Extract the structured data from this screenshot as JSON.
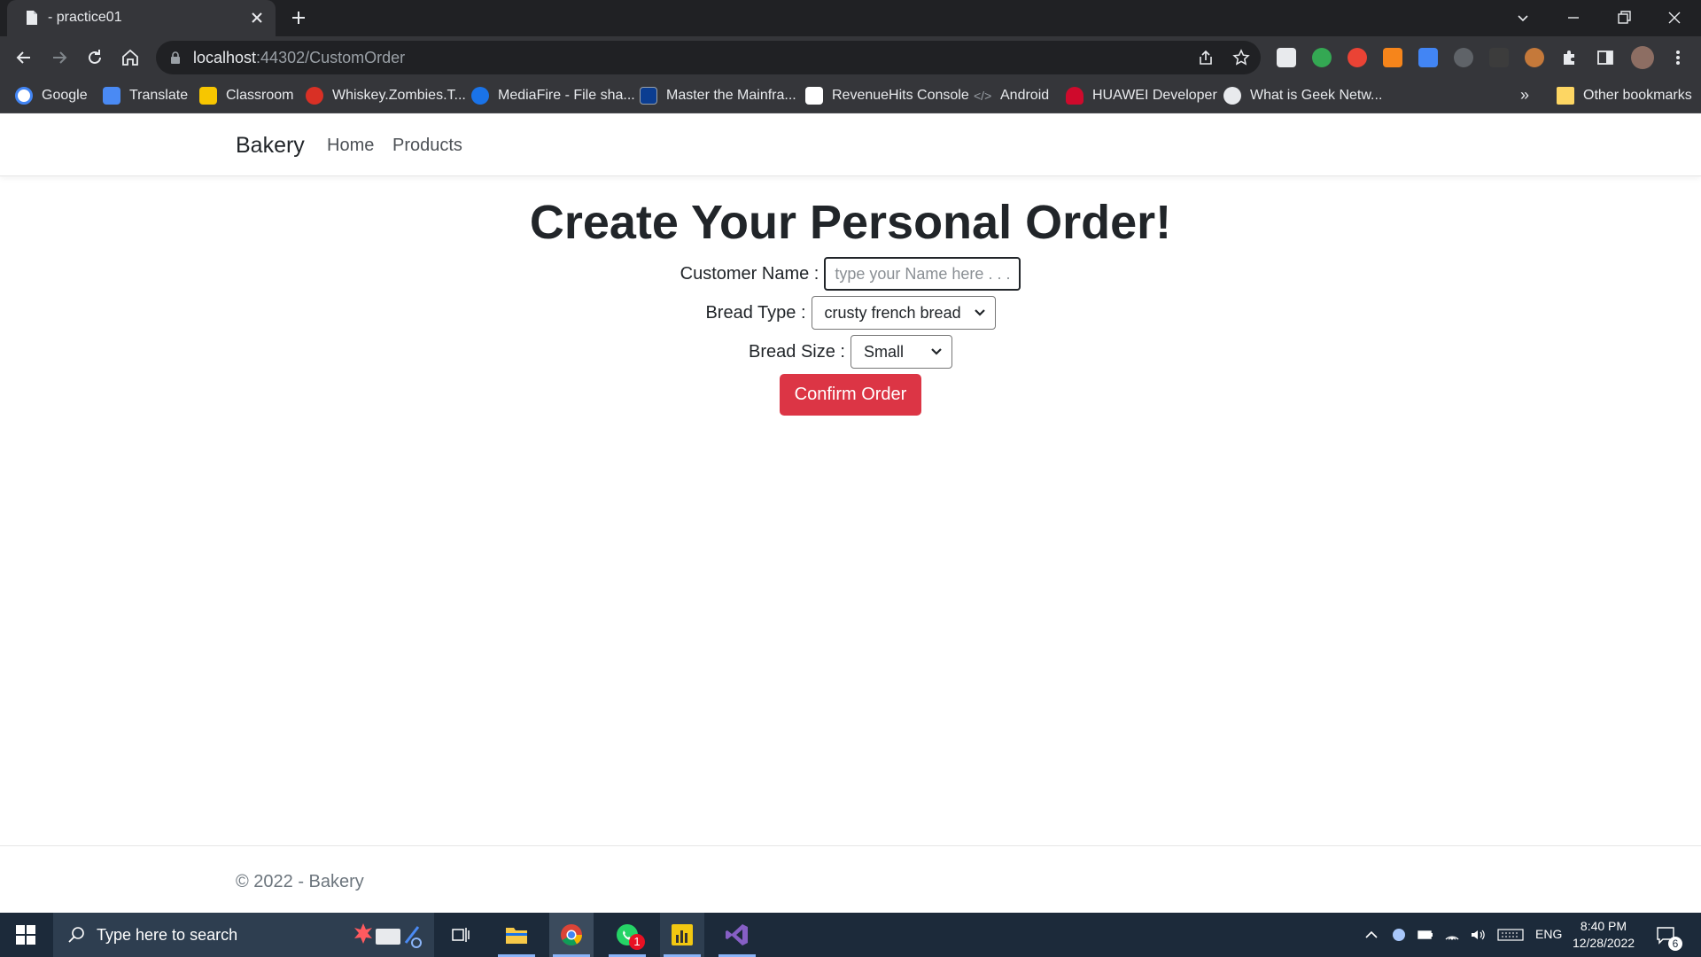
{
  "browser": {
    "tab_title": "- practice01",
    "url_host": "localhost",
    "url_rest": ":44302/CustomOrder",
    "bookmarks": [
      {
        "label": "Google",
        "icon": "google-icon",
        "color": "#4285f4"
      },
      {
        "label": "Translate",
        "icon": "translate-icon",
        "color": "#4a8af4"
      },
      {
        "label": "Classroom",
        "icon": "classroom-icon",
        "color": "#f7c600"
      },
      {
        "label": "Whiskey.Zombies.T...",
        "icon": "whiskey-icon",
        "color": "#d93025"
      },
      {
        "label": "MediaFire - File sha...",
        "icon": "mediafire-icon",
        "color": "#1a73e8"
      },
      {
        "label": "Master the Mainfra...",
        "icon": "mainframe-icon",
        "color": "#0b3d91"
      },
      {
        "label": "RevenueHits Console",
        "icon": "revenuehits-icon",
        "color": "#ffffff"
      },
      {
        "label": "Android",
        "icon": "code-icon",
        "color": "#9aa0a6"
      },
      {
        "label": "HUAWEI Developer",
        "icon": "huawei-icon",
        "color": "#cf0a2c"
      },
      {
        "label": "What is Geek Netw...",
        "icon": "globe-icon",
        "color": "#e8eaed"
      }
    ],
    "bookmarks_overflow": "»",
    "other_bookmarks": "Other bookmarks"
  },
  "site": {
    "brand": "Bakery",
    "nav": [
      "Home",
      "Products"
    ],
    "heading": "Create Your Personal Order!",
    "form": {
      "customer_name_label": "Customer Name :",
      "customer_name_placeholder": "type your Name here . . .",
      "customer_name_value": "",
      "bread_type_label": "Bread Type :",
      "bread_type_value": "crusty french bread",
      "bread_size_label": "Bread Size :",
      "bread_size_value": "Small",
      "confirm_label": "Confirm Order"
    },
    "footer": "© 2022 - Bakery",
    "accent_color": "#dc3545"
  },
  "taskbar": {
    "search_placeholder": "Type here to search",
    "lang": "ENG",
    "time": "8:40 PM",
    "date": "12/28/2022",
    "whatsapp_badge": "1",
    "notification_count": "6"
  }
}
